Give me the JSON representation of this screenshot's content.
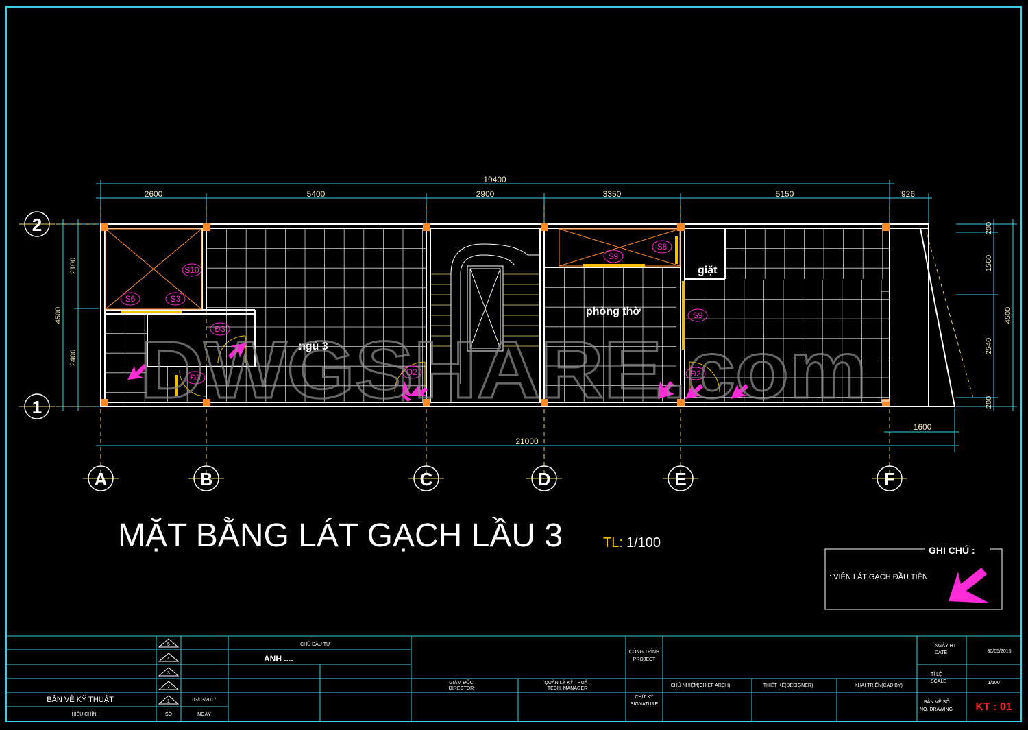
{
  "drawing": {
    "title": "MẶT BẰNG LÁT GẠCH LẦU 3",
    "scale_label": "TL:",
    "scale_value": "1/100",
    "watermark": "DWGSHARE.com"
  },
  "dimensions": {
    "total_top": "19400",
    "segments_top": [
      "2600",
      "5400",
      "2900",
      "3350",
      "5150",
      "926"
    ],
    "total_bottom": "21000",
    "balcony": "1600",
    "left_segments": [
      "2100",
      "2400"
    ],
    "left_total": "4500",
    "right_segments": [
      "200",
      "1560",
      "2540",
      "200"
    ],
    "right_total": "4500"
  },
  "axes": {
    "columns": [
      "A",
      "B",
      "C",
      "D",
      "E",
      "F"
    ],
    "rows": [
      "2",
      "1"
    ]
  },
  "rooms": {
    "bedroom": "ngủ 3",
    "altar_room": "phòng thờ",
    "laundry": "giặt"
  },
  "tags": {
    "s10": "S10",
    "s6": "S6",
    "s3": "S3",
    "s9a": "S9",
    "s8": "S8",
    "s9b": "S9",
    "d3a": "Đ3",
    "d3b": "Đ3",
    "d2a": "Đ2",
    "d2b": "Đ2"
  },
  "legend": {
    "title": "GHI CHÚ :",
    "item": ": VIÊN LÁT GẠCH ĐẦU TIÊN"
  },
  "title_block": {
    "revisions": [
      "5",
      "4",
      "3",
      "2",
      "1"
    ],
    "rev1_date": "03/03/2017",
    "drawing_type": "BẢN VẼ KỸ THUẬT",
    "revision_label": "HIỆU CHỈNH",
    "number_label": "SỐ",
    "date_label": "NGÀY",
    "owner_label": "CHỦ ĐẦU TƯ",
    "owner": "ANH ....",
    "director": "GIÁM ĐỐC",
    "director_en": "DIRECTOR",
    "tech_manager": "QUẢN LÝ KỸ THUẬT",
    "tech_manager_en": "TECH. MANAGER",
    "project": "CÔNG TRÌNH",
    "project_en": "PROJECT",
    "signature": "CHỮ KÝ",
    "signature_en": "SIGNATURE",
    "chief_arch": "CHỦ NHIỆM(CHIEF ARCH)",
    "designer": "THIẾT KẾ(DESIGNER)",
    "cad": "KHAI TRIỂN(CAD BY)",
    "date_done": "NGÀY HT",
    "date_done_en": "DATE",
    "date_value": "30/05/2015",
    "scale": "TỈ LỆ",
    "scale_en": "SCALE",
    "scale_val": "1/100",
    "drawing_no": "BẢN VẼ SỐ",
    "drawing_no_en": "NO. DRAWING",
    "sheet": "KT : 01"
  },
  "colors": {
    "background": "#000000",
    "frame": "#35d0e6",
    "wall": "#ffffff",
    "dimension": "#f2e8b0",
    "tag": "#ff2bd6",
    "door": "#f0c000",
    "column": "#ff8a2a",
    "sheet_code": "#ff2020"
  }
}
